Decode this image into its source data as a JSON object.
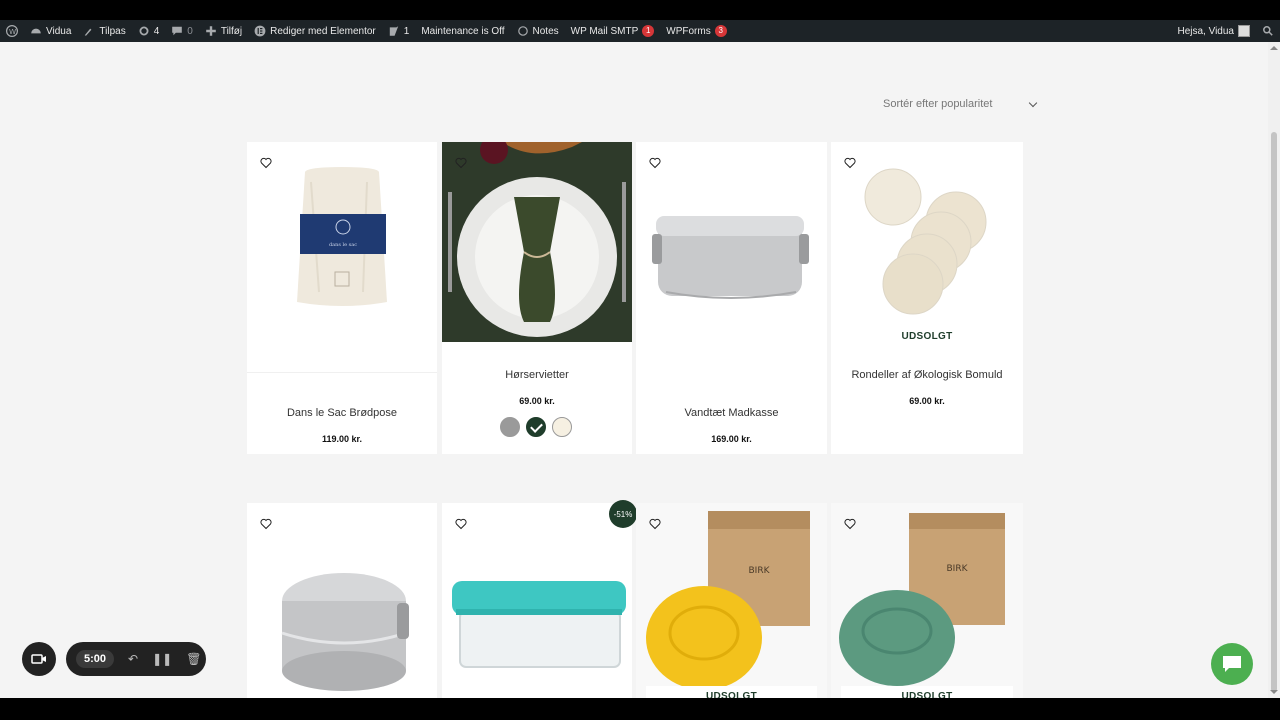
{
  "adminbar": {
    "site_name": "Vidua",
    "customize": "Tilpas",
    "updates_count": "4",
    "comments_count": "0",
    "new_label": "Tilføj",
    "elementor": "Rediger med Elementor",
    "yoast_count": "1",
    "maintenance": "Maintenance is Off",
    "notes": "Notes",
    "smtp": "WP Mail SMTP",
    "smtp_badge": "1",
    "wpforms": "WPForms",
    "wpforms_badge": "3",
    "greeting": "Hejsa, Vidua"
  },
  "sort": {
    "label": "Sortér efter popularitet"
  },
  "products_row1": [
    {
      "name": "Dans le Sac Brødpose",
      "price": "119.00 kr."
    },
    {
      "name": "Hørservietter",
      "price": "69.00 kr."
    },
    {
      "name": "Vandtæt Madkasse",
      "price": "169.00 kr."
    },
    {
      "name": "Rondeller af Økologisk Bomuld",
      "price": "69.00 kr.",
      "badge": "UDSOLGT"
    }
  ],
  "products_row2": [
    {
      "badge": ""
    },
    {
      "discount": "-51%"
    },
    {
      "badge": "UDSOLGT"
    },
    {
      "badge": "UDSOLGT"
    }
  ],
  "image_text": {
    "dans_le_sac": "dans le sac",
    "birk_1": "BIRK",
    "birk_2": "BIRK"
  },
  "recorder": {
    "time": "5:00"
  },
  "colors": {
    "brand_green": "#1f3d2b",
    "chat_green": "#4caf50",
    "adminbar": "#1d2327"
  }
}
